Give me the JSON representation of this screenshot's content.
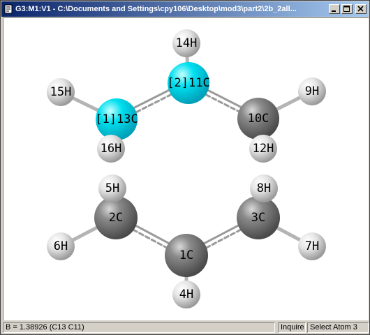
{
  "window": {
    "title": "G3:M1:V1 - C:\\Documents and Settings\\cpy106\\Desktop\\mod3\\part2\\2b_2all...",
    "icon": "gaussview-document-icon",
    "controls": [
      "minimize",
      "maximize",
      "close"
    ]
  },
  "molecule": {
    "atoms": [
      {
        "id": "13",
        "element": "C",
        "label": "[1]13C",
        "selected": true
      },
      {
        "id": "11",
        "element": "C",
        "label": "[2]11C",
        "selected": true
      },
      {
        "id": "10",
        "element": "C",
        "label": "10C"
      },
      {
        "id": "2",
        "element": "C",
        "label": "2C"
      },
      {
        "id": "3",
        "element": "C",
        "label": "3C"
      },
      {
        "id": "1",
        "element": "C",
        "label": "1C"
      },
      {
        "id": "14",
        "element": "H",
        "label": "14H"
      },
      {
        "id": "15",
        "element": "H",
        "label": "15H"
      },
      {
        "id": "16",
        "element": "H",
        "label": "16H"
      },
      {
        "id": "9",
        "element": "H",
        "label": "9H"
      },
      {
        "id": "12",
        "element": "H",
        "label": "12H"
      },
      {
        "id": "5",
        "element": "H",
        "label": "5H"
      },
      {
        "id": "8",
        "element": "H",
        "label": "8H"
      },
      {
        "id": "6",
        "element": "H",
        "label": "6H"
      },
      {
        "id": "7",
        "element": "H",
        "label": "7H"
      },
      {
        "id": "4",
        "element": "H",
        "label": "4H"
      }
    ],
    "colors": {
      "carbon": "#7a7a7a",
      "hydrogen": "#e0e0e0",
      "selected": "#00d8e8",
      "background": "#ffffff"
    }
  },
  "statusbar": {
    "measurement": "B = 1.38926 (C13 C11)",
    "mode": "Inquire",
    "action": "Select Atom 3"
  }
}
